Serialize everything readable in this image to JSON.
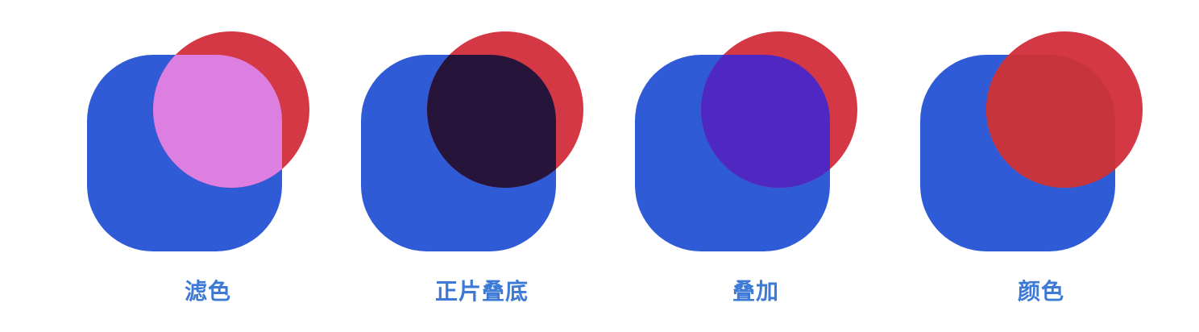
{
  "colors": {
    "square": "#2f5bd6",
    "circle": "#d53845",
    "caption": "#3d7ad6",
    "background": "#ffffff"
  },
  "demos": [
    {
      "label": "滤色",
      "blend_mode": "screen"
    },
    {
      "label": "正片叠底",
      "blend_mode": "multiply"
    },
    {
      "label": "叠加",
      "blend_mode": "overlay"
    },
    {
      "label": "颜色",
      "blend_mode": "color"
    }
  ]
}
